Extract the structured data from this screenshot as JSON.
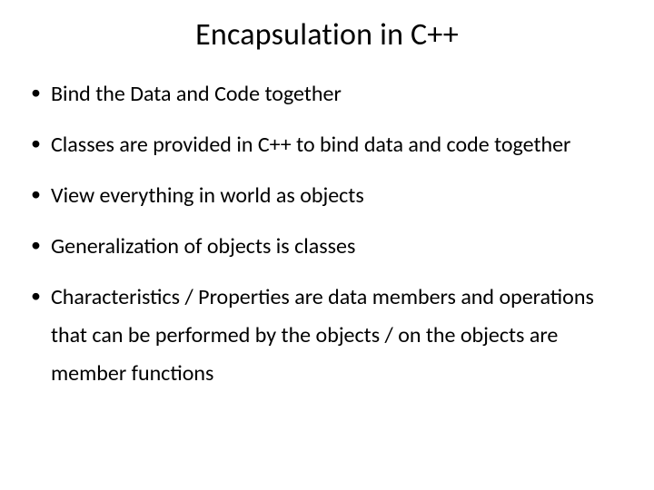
{
  "title": "Encapsulation in C++",
  "bullets": [
    "Bind the Data and Code together",
    "Classes are provided in C++ to bind data and code together",
    "View everything in world as objects",
    "Generalization of objects is classes",
    "Characteristics / Properties are data members and operations that can be performed by the objects / on the objects are member functions"
  ]
}
